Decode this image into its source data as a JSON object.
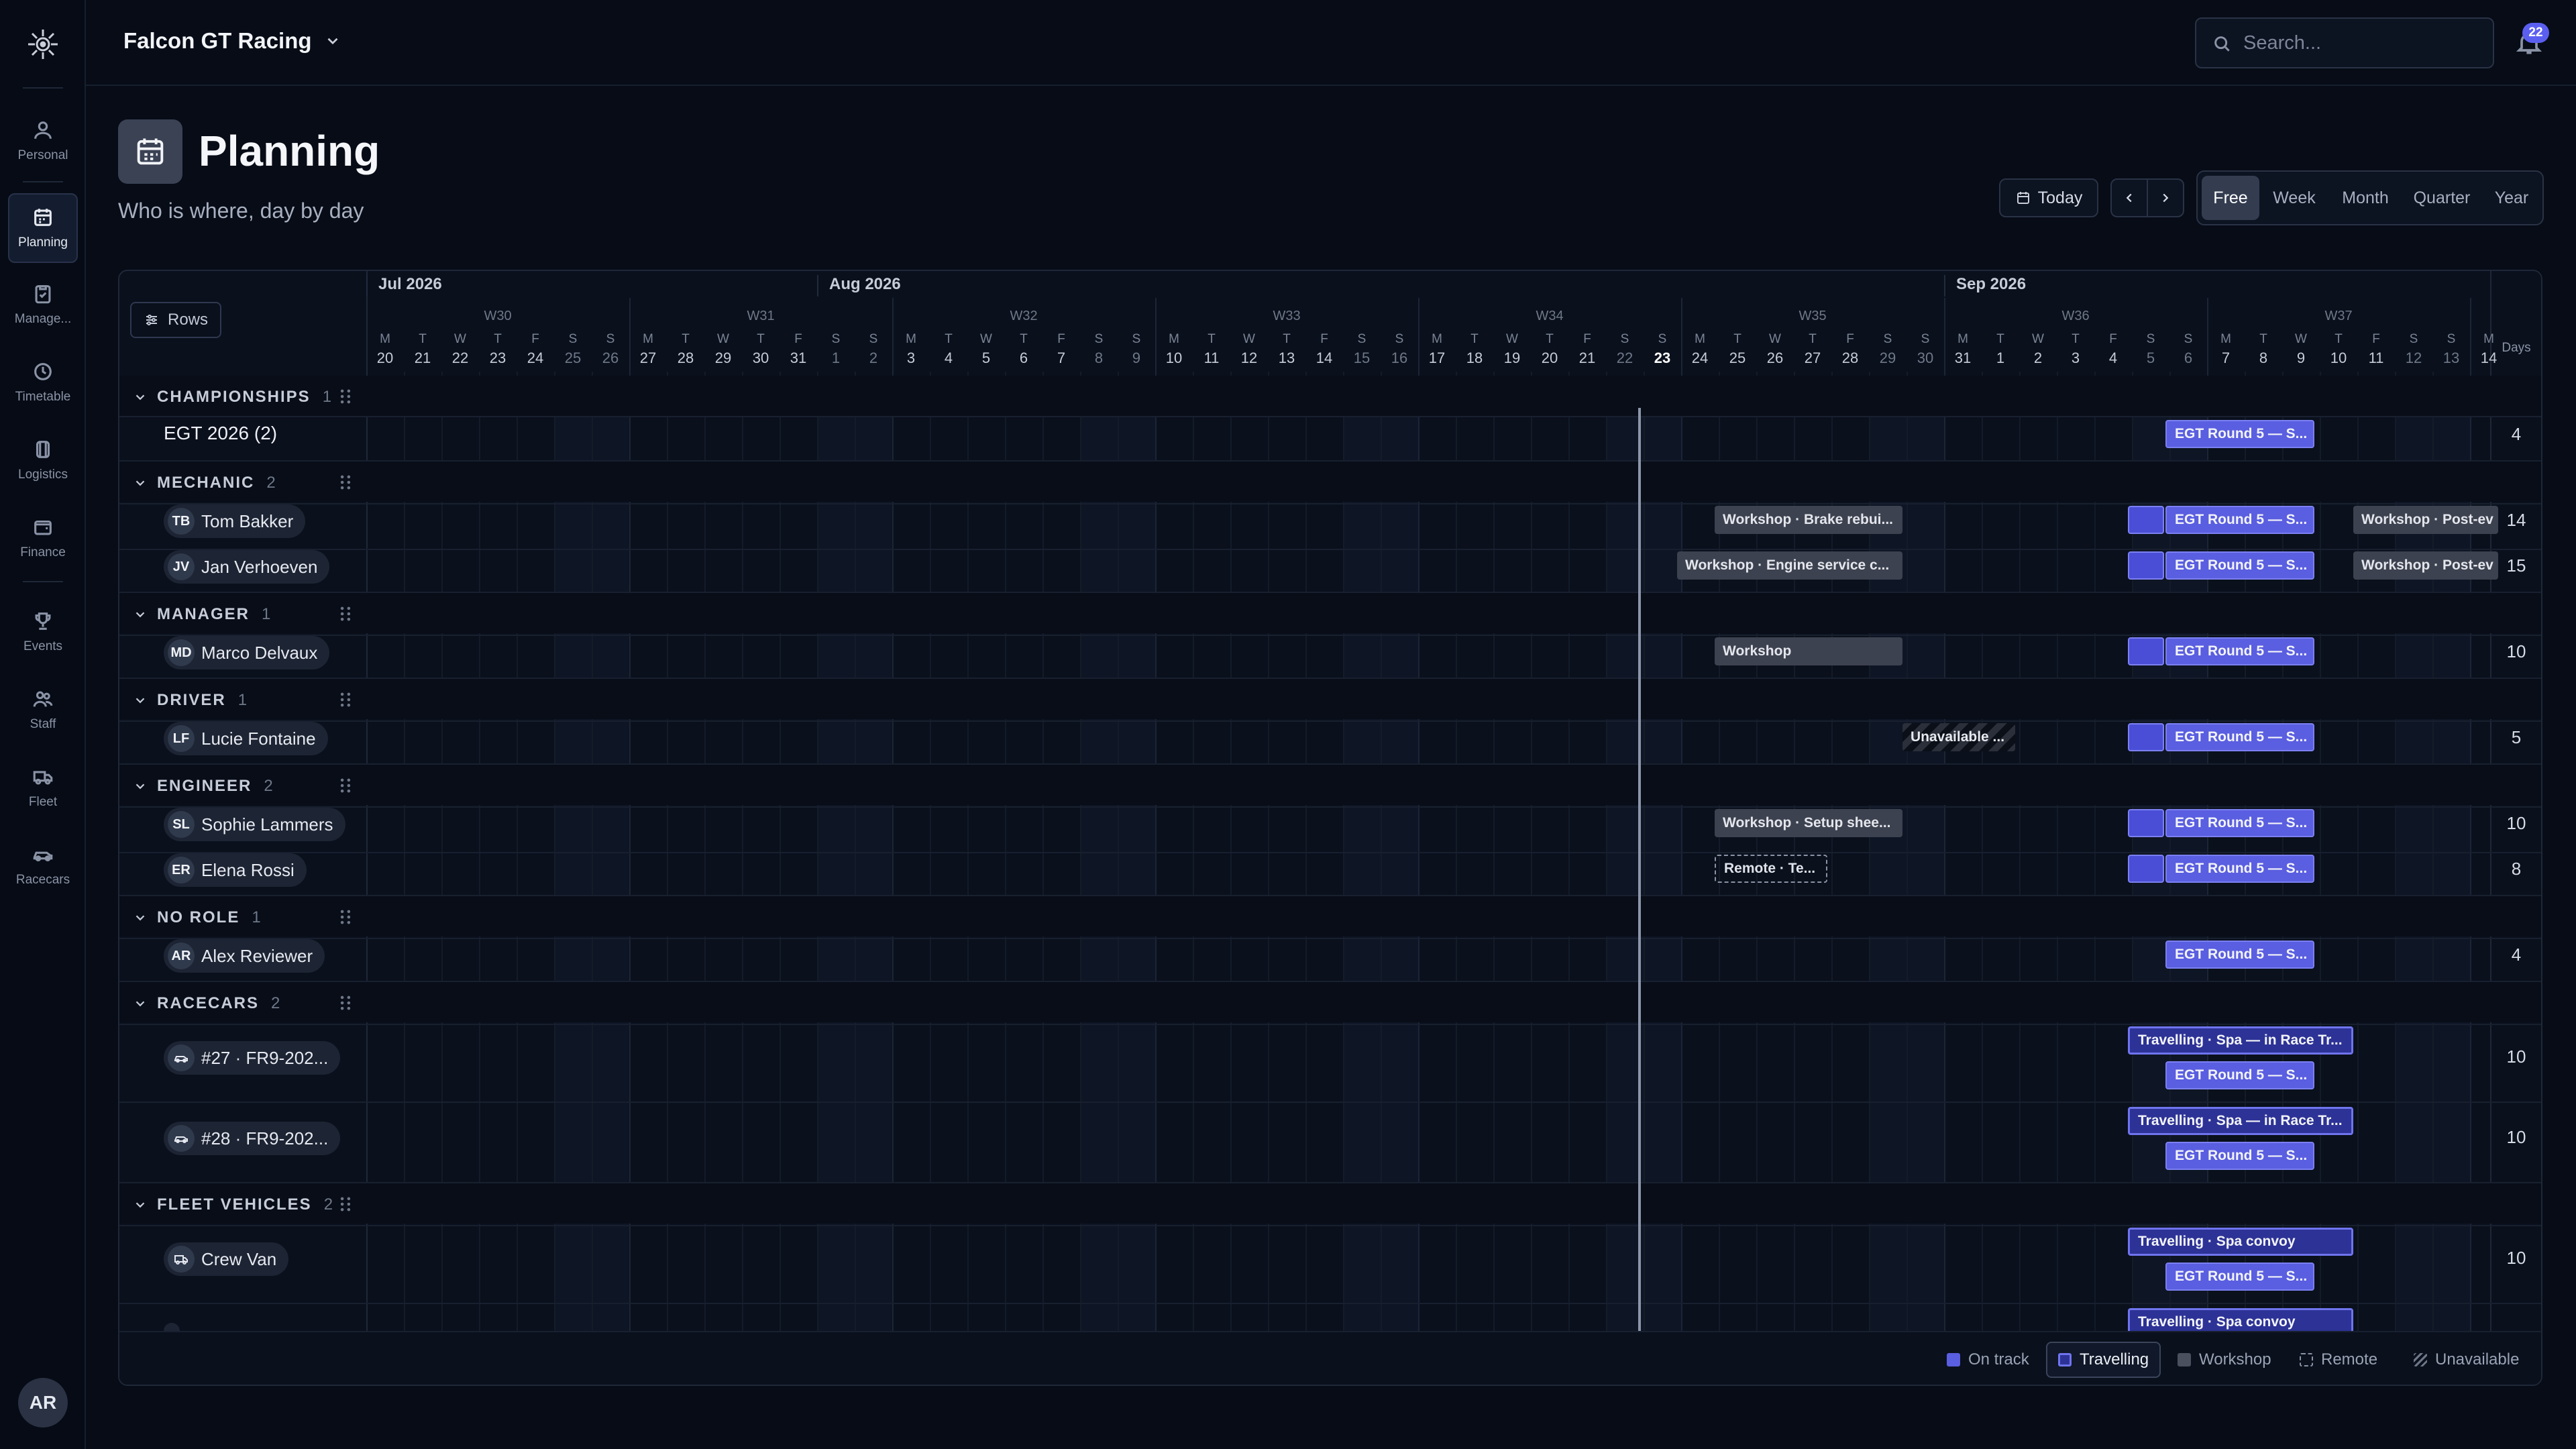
{
  "org": {
    "name": "Falcon GT Racing"
  },
  "search": {
    "placeholder": "Search..."
  },
  "notifications": {
    "count": "22"
  },
  "sidebar": {
    "items": [
      {
        "label": "Personal",
        "icon": "user-icon"
      },
      {
        "label": "Planning",
        "icon": "calendar-icon",
        "active": true
      },
      {
        "label": "Manage...",
        "icon": "clipboard-icon"
      },
      {
        "label": "Timetable",
        "icon": "clock-icon"
      },
      {
        "label": "Logistics",
        "icon": "box-icon"
      },
      {
        "label": "Finance",
        "icon": "wallet-icon"
      },
      {
        "label": "Events",
        "icon": "trophy-icon"
      },
      {
        "label": "Staff",
        "icon": "users-icon"
      },
      {
        "label": "Fleet",
        "icon": "truck-icon"
      },
      {
        "label": "Racecars",
        "icon": "car-icon"
      }
    ],
    "user_initials": "AR"
  },
  "page": {
    "title": "Planning",
    "subtitle": "Who is where, day by day"
  },
  "toolbar": {
    "today": "Today",
    "views": [
      "Free",
      "Week",
      "Month",
      "Quarter",
      "Year"
    ],
    "active_view": "Free"
  },
  "timeline": {
    "rows_label": "Rows",
    "days_header": "Days",
    "months": [
      "Jul 2026",
      "Aug 2026",
      "Sep 2026"
    ],
    "weeks": [
      "W30",
      "W31",
      "W32",
      "W33",
      "W34",
      "W35",
      "W36",
      "W37"
    ],
    "today": "23",
    "days": [
      {
        "w": "M",
        "d": "20"
      },
      {
        "w": "T",
        "d": "21"
      },
      {
        "w": "W",
        "d": "22"
      },
      {
        "w": "T",
        "d": "23"
      },
      {
        "w": "F",
        "d": "24"
      },
      {
        "w": "S",
        "d": "25"
      },
      {
        "w": "S",
        "d": "26"
      },
      {
        "w": "M",
        "d": "27"
      },
      {
        "w": "T",
        "d": "28"
      },
      {
        "w": "W",
        "d": "29"
      },
      {
        "w": "T",
        "d": "30"
      },
      {
        "w": "F",
        "d": "31"
      },
      {
        "w": "S",
        "d": "1"
      },
      {
        "w": "S",
        "d": "2"
      },
      {
        "w": "M",
        "d": "3"
      },
      {
        "w": "T",
        "d": "4"
      },
      {
        "w": "W",
        "d": "5"
      },
      {
        "w": "T",
        "d": "6"
      },
      {
        "w": "F",
        "d": "7"
      },
      {
        "w": "S",
        "d": "8"
      },
      {
        "w": "S",
        "d": "9"
      },
      {
        "w": "M",
        "d": "10"
      },
      {
        "w": "T",
        "d": "11"
      },
      {
        "w": "W",
        "d": "12"
      },
      {
        "w": "T",
        "d": "13"
      },
      {
        "w": "F",
        "d": "14"
      },
      {
        "w": "S",
        "d": "15"
      },
      {
        "w": "S",
        "d": "16"
      },
      {
        "w": "M",
        "d": "17"
      },
      {
        "w": "T",
        "d": "18"
      },
      {
        "w": "W",
        "d": "19"
      },
      {
        "w": "T",
        "d": "20"
      },
      {
        "w": "F",
        "d": "21"
      },
      {
        "w": "S",
        "d": "22"
      },
      {
        "w": "S",
        "d": "23"
      },
      {
        "w": "M",
        "d": "24"
      },
      {
        "w": "T",
        "d": "25"
      },
      {
        "w": "W",
        "d": "26"
      },
      {
        "w": "T",
        "d": "27"
      },
      {
        "w": "F",
        "d": "28"
      },
      {
        "w": "S",
        "d": "29"
      },
      {
        "w": "S",
        "d": "30"
      },
      {
        "w": "M",
        "d": "31"
      },
      {
        "w": "T",
        "d": "1"
      },
      {
        "w": "W",
        "d": "2"
      },
      {
        "w": "T",
        "d": "3"
      },
      {
        "w": "F",
        "d": "4"
      },
      {
        "w": "S",
        "d": "5"
      },
      {
        "w": "S",
        "d": "6"
      },
      {
        "w": "M",
        "d": "7"
      },
      {
        "w": "T",
        "d": "8"
      },
      {
        "w": "W",
        "d": "9"
      },
      {
        "w": "T",
        "d": "10"
      },
      {
        "w": "F",
        "d": "11"
      },
      {
        "w": "S",
        "d": "12"
      },
      {
        "w": "S",
        "d": "13"
      },
      {
        "w": "M",
        "d": "14"
      }
    ]
  },
  "groups": [
    {
      "label": "CHAMPIONSHIPS",
      "count": "1"
    },
    {
      "label": "MECHANIC",
      "count": "2"
    },
    {
      "label": "MANAGER",
      "count": "1"
    },
    {
      "label": "DRIVER",
      "count": "1"
    },
    {
      "label": "ENGINEER",
      "count": "2"
    },
    {
      "label": "NO ROLE",
      "count": "1"
    },
    {
      "label": "RACECARS",
      "count": "2"
    },
    {
      "label": "FLEET VEHICLES",
      "count": "2"
    }
  ],
  "rows": [
    {
      "name": "EGT 2026 (2)",
      "days": "4"
    },
    {
      "initials": "TB",
      "name": "Tom Bakker",
      "days": "14"
    },
    {
      "initials": "JV",
      "name": "Jan Verhoeven",
      "days": "15"
    },
    {
      "initials": "MD",
      "name": "Marco Delvaux",
      "days": "10"
    },
    {
      "initials": "LF",
      "name": "Lucie Fontaine",
      "days": "5"
    },
    {
      "initials": "SL",
      "name": "Sophie Lammers",
      "days": "10"
    },
    {
      "initials": "ER",
      "name": "Elena Rossi",
      "days": "8"
    },
    {
      "initials": "AR",
      "name": "Alex Reviewer",
      "days": "4"
    },
    {
      "name": "#27 · FR9-202...",
      "days": "10"
    },
    {
      "name": "#28 · FR9-202...",
      "days": "10"
    },
    {
      "name": "Crew Van",
      "days": "10"
    }
  ],
  "events": {
    "egt_round": "EGT Round 5 — S...",
    "ws_brake": "Workshop · Brake rebui...",
    "ws_post": "Workshop · Post-ev",
    "ws_engine": "Workshop · Engine service c...",
    "ws_plain": "Workshop",
    "unavailable": "Unavailable ...",
    "ws_setup": "Workshop · Setup shee...",
    "remote": "Remote · Te...",
    "travel_spa": "Travelling · Spa — in Race Tr...",
    "travel_convoy": "Travelling · Spa convoy"
  },
  "legend": [
    {
      "label": "On track",
      "color": "#5a5ee0"
    },
    {
      "label": "Travelling",
      "color": "#2d3296",
      "active": true
    },
    {
      "label": "Workshop",
      "color": "#4a505e"
    },
    {
      "label": "Remote",
      "color": "dashed"
    },
    {
      "label": "Unavailable",
      "color": "striped"
    }
  ],
  "colors": {
    "accent": "#5b5ff0",
    "background": "#070c17",
    "panel": "#0a101c"
  }
}
